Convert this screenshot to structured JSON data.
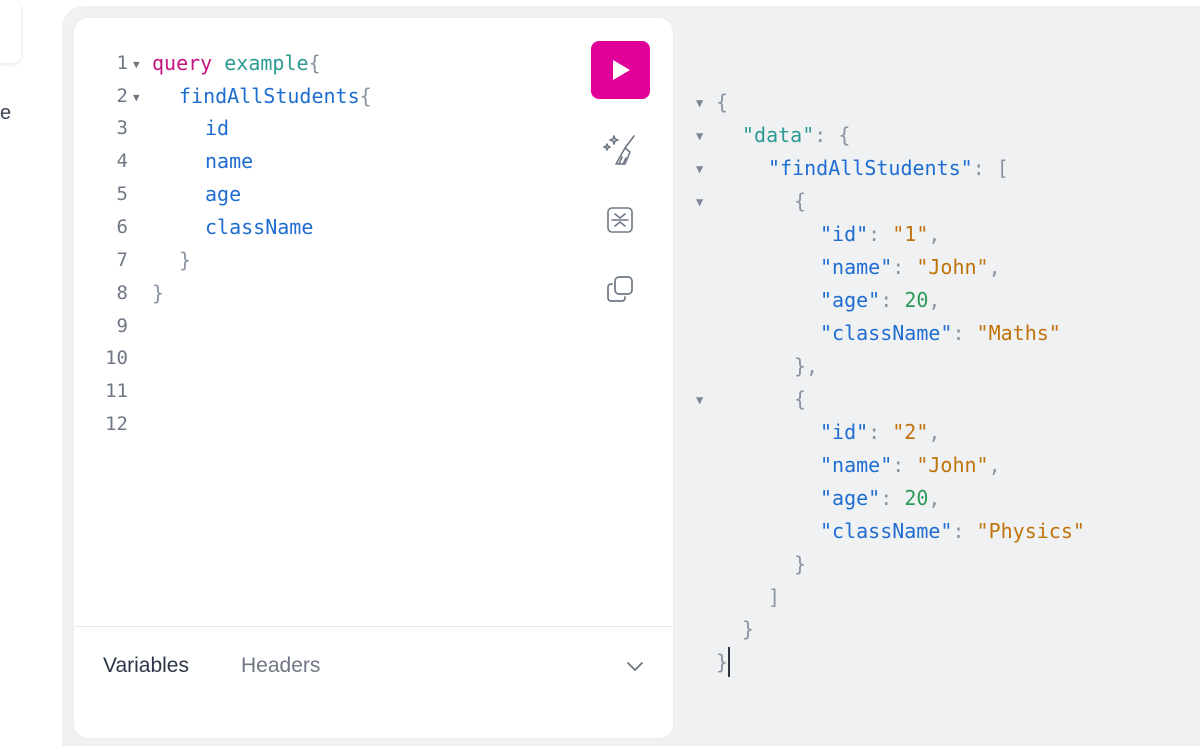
{
  "left_fragment": "e",
  "editor": {
    "line_numbers": [
      "1",
      "2",
      "3",
      "4",
      "5",
      "6",
      "7",
      "8",
      "9",
      "10",
      "11",
      "12"
    ],
    "code": {
      "query_keyword": "query",
      "operation_name": "example",
      "brace_open": "{",
      "brace_close": "}",
      "root_field": "findAllStudents",
      "fields": [
        "id",
        "name",
        "age",
        "className"
      ]
    }
  },
  "toolbar": {
    "run_icon": "play-icon",
    "prettify_icon": "prettify-icon",
    "merge_icon": "merge-fragments-icon",
    "copy_icon": "copy-icon"
  },
  "bottom_tabs": {
    "variables": "Variables",
    "headers": "Headers",
    "toggle_icon": "chevron-down-icon"
  },
  "result": {
    "data_key": "\"data\"",
    "root_key": "\"findAllStudents\"",
    "students": [
      {
        "id_key": "\"id\"",
        "id": "\"1\"",
        "name_key": "\"name\"",
        "name": "\"John\"",
        "age_key": "\"age\"",
        "age": "20",
        "class_key": "\"className\"",
        "className": "\"Maths\""
      },
      {
        "id_key": "\"id\"",
        "id": "\"2\"",
        "name_key": "\"name\"",
        "name": "\"John\"",
        "age_key": "\"age\"",
        "age": "20",
        "class_key": "\"className\"",
        "className": "\"Physics\""
      }
    ]
  },
  "colors": {
    "accent": "#e10098",
    "keyword": "#c4157f",
    "field": "#1f6dd0",
    "string": "#c0730b",
    "number": "#2f9a58"
  }
}
